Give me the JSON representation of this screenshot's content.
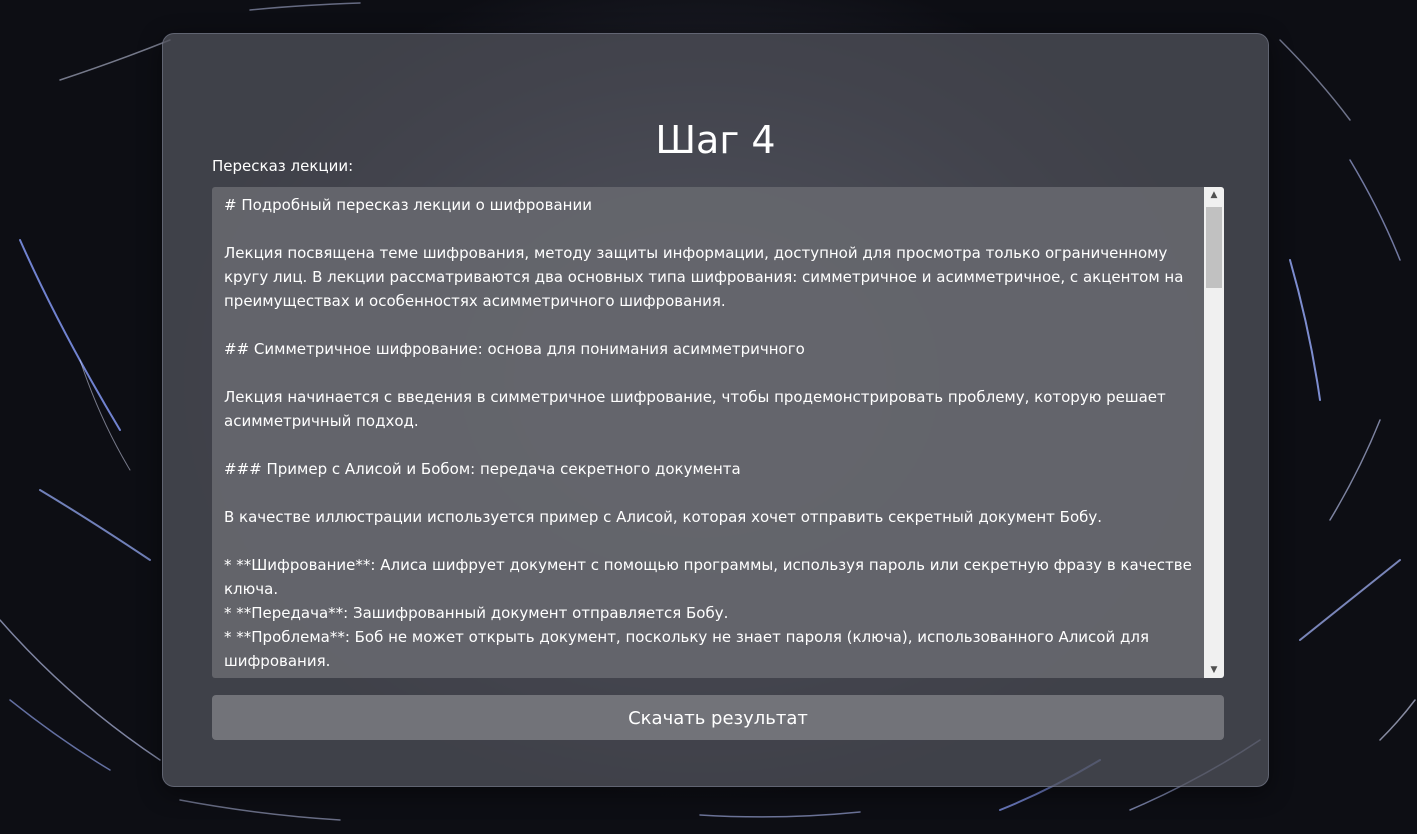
{
  "card": {
    "title": "Шаг 4",
    "summary_label": "Пересказ лекции:",
    "summary_text": "# Подробный пересказ лекции о шифровании\n\nЛекция посвящена теме шифрования, методу защиты информации, доступной для просмотра только ограниченному кругу лиц. В лекции рассматриваются два основных типа шифрования: симметричное и асимметричное, с акцентом на преимуществах и особенностях асимметричного шифрования.\n\n## Симметричное шифрование: основа для понимания асимметричного\n\nЛекция начинается с введения в симметричное шифрование, чтобы продемонстрировать проблему, которую решает асимметричный подход.\n\n### Пример с Алисой и Бобом: передача секретного документа\n\nВ качестве иллюстрации используется пример с Алисой, которая хочет отправить секретный документ Бобу.\n\n* **Шифрование**: Алиса шифрует документ с помощью программы, используя пароль или секретную фразу в качестве ключа.\n* **Передача**: Зашифрованный документ отправляется Бобу.\n* **Проблема**: Боб не может открыть документ, поскольку не знает пароля (ключа), использованного Алисой для шифрования.",
    "download_button": "Скачать результат"
  },
  "scrollbar": {
    "up_arrow_icon": "triangle-up-icon",
    "down_arrow_icon": "triangle-down-icon"
  },
  "colors": {
    "card_background": "#4e4f58",
    "textarea_background": "#66676e",
    "button_background": "#727379",
    "text": "#ffffff"
  }
}
